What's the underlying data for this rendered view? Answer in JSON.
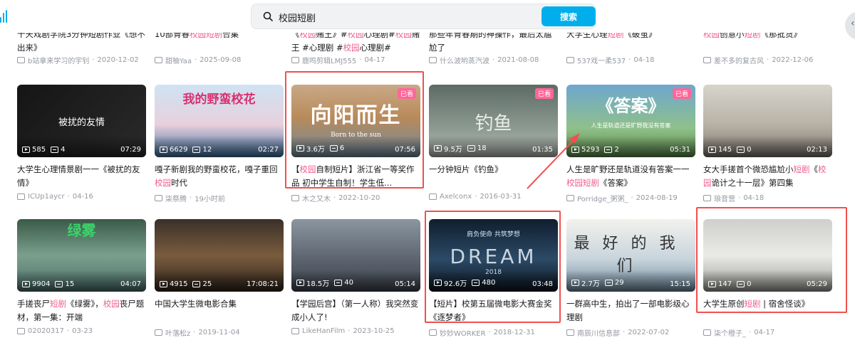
{
  "search": {
    "query": "校园短剧",
    "button_label": "搜索"
  },
  "colors": {
    "accent": "#00aeec",
    "highlight": "#f25d8e",
    "annotation": "#f0504f",
    "watched_badge": "#ff6699"
  },
  "top_row": [
    {
      "title": [
        {
          "t": "十天戏剧学院3分钟短剧作业《想不出来》"
        }
      ],
      "uploader": "b站拿来学习的宇钊",
      "date": "2020-12-02"
    },
    {
      "title": [
        {
          "t": "10部青春"
        },
        {
          "t": "校园",
          "h": true
        },
        {
          "t": "短剧",
          "h": true
        },
        {
          "t": "合集"
        }
      ],
      "uploader": "甜柚Yaa",
      "date": "2025-09-08"
    },
    {
      "title": [
        {
          "t": "《"
        },
        {
          "t": "校园",
          "h": true
        },
        {
          "t": "赌王》#"
        },
        {
          "t": "校园",
          "h": true
        },
        {
          "t": "心理剧#"
        },
        {
          "t": "校园",
          "h": true
        },
        {
          "t": "赌王 #心理剧 #"
        },
        {
          "t": "校园",
          "h": true
        },
        {
          "t": "心理剧#"
        }
      ],
      "uploader": "鹿鸣剪辑LMJ555",
      "date": "04-17"
    },
    {
      "title": [
        {
          "t": "那些年青春期的神操作，最后太尴尬了"
        }
      ],
      "uploader": "什么波哟蒸汽波",
      "date": "2021-08-08"
    },
    {
      "title": [
        {
          "t": "大学生心理"
        },
        {
          "t": "短剧",
          "h": true
        },
        {
          "t": "《破茧》"
        }
      ],
      "uploader": "537戏一柔537",
      "date": "04-18"
    },
    {
      "title": [
        {
          "t": "校园",
          "h": true
        },
        {
          "t": "创意小"
        },
        {
          "t": "短剧",
          "h": true
        },
        {
          "t": "《那批货》"
        }
      ],
      "uploader": "差不多的复古风",
      "date": "2022-12-06"
    }
  ],
  "row2": [
    {
      "overlay": "被扰的友情",
      "plays": "585",
      "danmaku": "4",
      "duration": "07:29",
      "watched": false,
      "title": [
        {
          "t": "大学生心理情景剧一一《被扰的友情》"
        }
      ],
      "uploader": "ICUp1aycr",
      "date": "04-16"
    },
    {
      "overlay": "我的野蛮校花",
      "plays": "6629",
      "danmaku": "12",
      "duration": "02:27",
      "watched": false,
      "title": [
        {
          "t": "嘎子新剧我的野蛮校花，嘎子重回"
        },
        {
          "t": "校园",
          "h": true
        },
        {
          "t": "时代"
        }
      ],
      "uploader": "柒祭腾",
      "date": "19小时前"
    },
    {
      "overlay": "向阳而生",
      "overlay_sub": "Born to the sun",
      "plays": "3.6万",
      "danmaku": "6",
      "duration": "07:56",
      "watched": true,
      "watched_label": "已看",
      "title": [
        {
          "t": "【"
        },
        {
          "t": "校园",
          "h": true
        },
        {
          "t": "自制短片】浙江省一等奖作品 初中学生自制！学生低..."
        }
      ],
      "uploader": "木之又木",
      "date": "2022-10-20"
    },
    {
      "overlay": "钓鱼",
      "plays": "9.5万",
      "danmaku": "18",
      "duration": "01:35",
      "watched": true,
      "watched_label": "已看",
      "title": [
        {
          "t": "一分钟短片《钓鱼》"
        }
      ],
      "uploader": "Axelconx",
      "date": "2016-03-31"
    },
    {
      "overlay": "《答案》",
      "overlay_sub": "人生是轨道还是旷野我没有答案",
      "plays": "5293",
      "danmaku": "2",
      "duration": "05:31",
      "watched": true,
      "watched_label": "已看",
      "title": [
        {
          "t": "人生是旷野还是轨道没有答案一一"
        },
        {
          "t": "校园",
          "h": true
        },
        {
          "t": "短剧",
          "h": true
        },
        {
          "t": "《答案》"
        }
      ],
      "uploader": "Porridge_粥粥_",
      "date": "2024-08-19"
    },
    {
      "overlay": "",
      "plays": "145",
      "danmaku": "0",
      "duration": "02:13",
      "watched": false,
      "title": [
        {
          "t": "女大手搓首个微恐尴尬小"
        },
        {
          "t": "短剧",
          "h": true
        },
        {
          "t": "《"
        },
        {
          "t": "校园",
          "h": true
        },
        {
          "t": "诡计之十一层》第四集"
        }
      ],
      "uploader": "琅音营",
      "date": "04-18"
    }
  ],
  "row3": [
    {
      "overlay": "绿雾",
      "plays": "9904",
      "danmaku": "15",
      "duration": "04:07",
      "watched": false,
      "title": [
        {
          "t": "手搓丧尸"
        },
        {
          "t": "短剧",
          "h": true
        },
        {
          "t": "《绿雾》，"
        },
        {
          "t": "校园",
          "h": true
        },
        {
          "t": "丧尸题材，第一集：开端"
        }
      ],
      "uploader": "02020317",
      "date": "03-23"
    },
    {
      "overlay": "",
      "plays": "4915",
      "danmaku": "25",
      "duration": "17:08:21",
      "watched": false,
      "title": [
        {
          "t": "中国大学生微电影合集"
        }
      ],
      "uploader": "叶落松z",
      "date": "2019-11-04"
    },
    {
      "overlay": "",
      "plays": "18.5万",
      "danmaku": "40",
      "duration": "05:14",
      "watched": false,
      "title": [
        {
          "t": "【学园后宫】（第一人称）我突然变成小人了!"
        }
      ],
      "uploader": "LikeHanFilm",
      "date": "2023-10-25"
    },
    {
      "overlay": "DREAM",
      "overlay_sub": "肩负使命  共筑梦想",
      "overlay_year": "2018",
      "plays": "92.6万",
      "danmaku": "480",
      "duration": "03:48",
      "watched": false,
      "title": [
        {
          "t": "【短片】校第五届微电影大赛金奖《逐梦者》"
        }
      ],
      "uploader": "妙妙WORKER",
      "date": "2018-12-31"
    },
    {
      "overlay": "最好的我们",
      "plays": "2.7万",
      "danmaku": "29",
      "duration": "15:15",
      "watched": false,
      "title": [
        {
          "t": "一群高中生，拍出了一部电影级心理剧"
        }
      ],
      "uploader": "南辰川信息部",
      "date": "2022-07-02"
    },
    {
      "overlay": "",
      "plays": "147",
      "danmaku": "0",
      "duration": "05:29",
      "watched": false,
      "title": [
        {
          "t": "大学生原创"
        },
        {
          "t": "短剧",
          "h": true
        },
        {
          "t": " | 宿舍怪谈》"
        }
      ],
      "uploader": "柒个橙子_",
      "date": "04-17"
    }
  ]
}
